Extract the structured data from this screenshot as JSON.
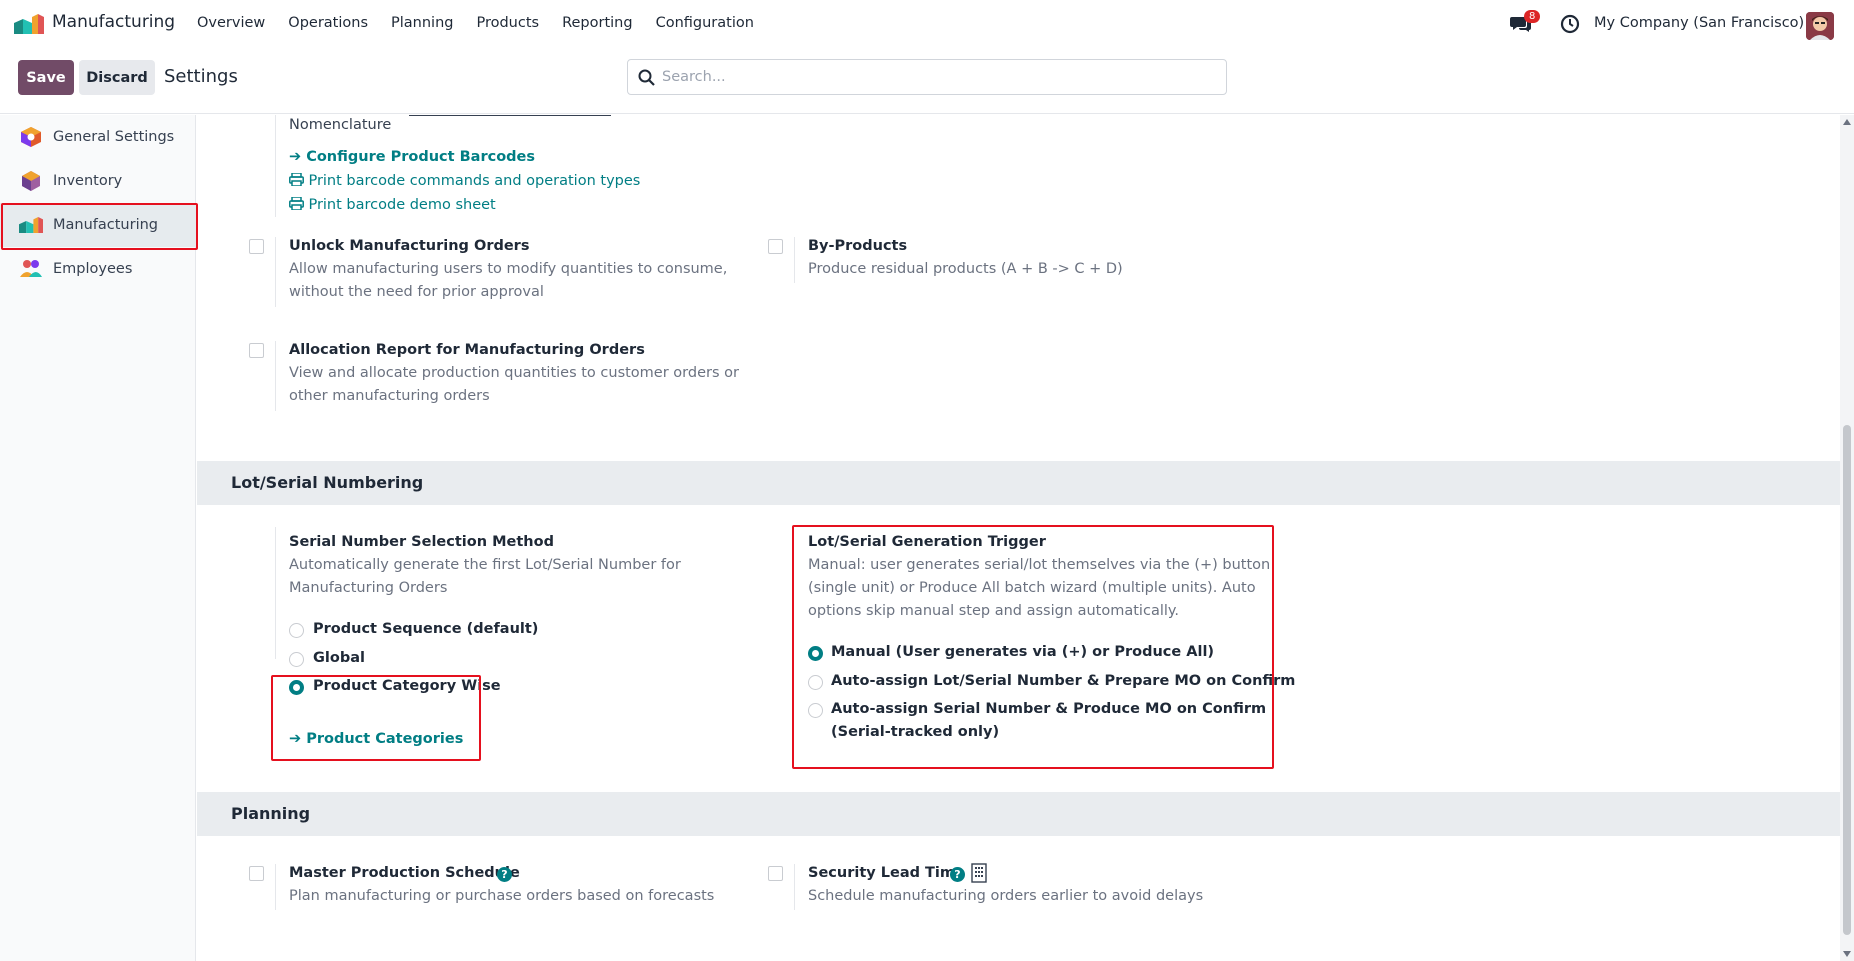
{
  "navbar": {
    "app_name": "Manufacturing",
    "menu": [
      "Overview",
      "Operations",
      "Planning",
      "Products",
      "Reporting",
      "Configuration"
    ],
    "messages_badge": "8",
    "company": "My Company (San Francisco)"
  },
  "control": {
    "save_label": "Save",
    "discard_label": "Discard",
    "title": "Settings",
    "search_placeholder": "Search..."
  },
  "sidebar": {
    "items": [
      {
        "label": "General Settings",
        "icon": "general-settings-icon"
      },
      {
        "label": "Inventory",
        "icon": "inventory-icon"
      },
      {
        "label": "Manufacturing",
        "icon": "manufacturing-icon",
        "active": true
      },
      {
        "label": "Employees",
        "icon": "employees-icon"
      }
    ]
  },
  "barcode": {
    "nomenclature_label": "Nomenclature",
    "configure_link": "Configure Product Barcodes",
    "print_commands_link": "Print barcode commands and operation types",
    "print_demo_link": "Print barcode demo sheet"
  },
  "settings": {
    "unlock": {
      "title": "Unlock Manufacturing Orders",
      "desc1": "Allow manufacturing users to modify quantities to consume,",
      "desc2": "without the need for prior approval"
    },
    "byproducts": {
      "title": "By-Products",
      "desc1": "Produce residual products (A + B -> C + D)"
    },
    "allocation": {
      "title": "Allocation Report for Manufacturing Orders",
      "desc1": "View and allocate production quantities to customer orders or",
      "desc2": "other manufacturing orders"
    }
  },
  "lot_serial": {
    "section_title": "Lot/Serial Numbering",
    "selection": {
      "title": "Serial Number Selection Method",
      "desc1": "Automatically generate the first Lot/Serial Number for",
      "desc2": "Manufacturing Orders",
      "options": [
        "Product Sequence (default)",
        "Global",
        "Product Category Wise"
      ],
      "selected": "Product Category Wise",
      "link": "Product Categories"
    },
    "trigger": {
      "title": "Lot/Serial Generation Trigger",
      "desc1": "Manual: user generates serial/lot themselves via the (+) button",
      "desc2": "(single unit) or Produce All batch wizard (multiple units). Auto",
      "desc3": "options skip manual step and assign automatically.",
      "options": [
        "Manual (User generates via (+) or Produce All)",
        "Auto-assign Lot/Serial Number & Prepare MO on Confirm",
        "Auto-assign Serial Number & Produce MO on Confirm",
        "(Serial-tracked only)"
      ],
      "selected": "Manual (User generates via (+) or Produce All)"
    }
  },
  "planning": {
    "section_title": "Planning",
    "mps": {
      "title": "Master Production Schedule",
      "desc": "Plan manufacturing or purchase orders based on forecasts"
    },
    "lead_time": {
      "title": "Security Lead Time",
      "desc": "Schedule manufacturing orders earlier to avoid delays"
    }
  },
  "colors": {
    "brand": "#714b67",
    "link": "#017e84",
    "highlight": "#e5101e"
  }
}
